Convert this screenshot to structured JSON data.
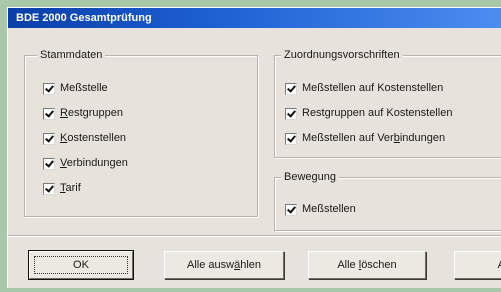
{
  "window": {
    "title": "BDE 2000 Gesamtprüfung"
  },
  "groups": {
    "stammdaten": {
      "legend": "Stammdaten",
      "items": [
        {
          "pre": "",
          "ul": "",
          "post": "Meßstelle",
          "checked": true
        },
        {
          "pre": "",
          "ul": "R",
          "post": "estgruppen",
          "checked": true
        },
        {
          "pre": "",
          "ul": "K",
          "post": "ostenstellen",
          "checked": true
        },
        {
          "pre": "",
          "ul": "V",
          "post": "erbindungen",
          "checked": true
        },
        {
          "pre": "",
          "ul": "T",
          "post": "arif",
          "checked": true
        }
      ]
    },
    "zuordnung": {
      "legend": "Zuordnungsvorschriften",
      "items": [
        {
          "pre": "Meßstellen auf Kostenstellen",
          "ul": "",
          "post": "",
          "checked": true
        },
        {
          "pre": "Restgruppen auf Kostenstellen",
          "ul": "",
          "post": "",
          "checked": true
        },
        {
          "pre": "Meßstellen auf Ver",
          "ul": "b",
          "post": "indungen",
          "checked": true
        }
      ]
    },
    "bewegung": {
      "legend": "Bewegung",
      "items": [
        {
          "pre": "Meßstellen",
          "ul": "",
          "post": "",
          "checked": true
        }
      ]
    }
  },
  "buttons": {
    "ok": "OK",
    "select_all": {
      "pre": "Alle ausw",
      "ul": "ä",
      "post": "hlen"
    },
    "delete_all": {
      "pre": "Alle ",
      "ul": "l",
      "post": "öschen"
    },
    "partial": "A"
  }
}
